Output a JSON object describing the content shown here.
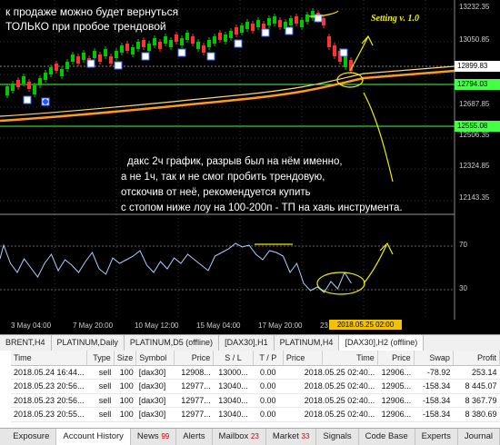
{
  "colors": {
    "background": "#000000",
    "candle_up": "#00c800",
    "candle_down": "#ff3333",
    "ma_outer": "#ff9a1a",
    "ma_inner": "#ffd27a",
    "annotation": "#f0f000",
    "oscillator": "#a9cfff",
    "green_level": "#44ff44",
    "current_price": "#ffffff"
  },
  "annotations": {
    "top_line1": "к продаже можно будет вернуться",
    "top_line2": "ТОЛЬКО при пробое трендовой",
    "setting": "Setting v. 1.0",
    "mid_line1": "дакс 2ч график, разрыв был на нём именно,",
    "mid_line2": "а не 1ч, так и не смог пробить трендовую,",
    "mid_line3": "отскочив от неё, рекомендуется купить",
    "mid_line4": "с стопом ниже лоу на 100-200п - ТП на хаяь инструмента."
  },
  "price_axis": {
    "labels": [
      "13232.35",
      "13050.85",
      "12899.83",
      "12794.03",
      "12687.85",
      "12555.08",
      "12506.35",
      "12324.85",
      "12143.35"
    ],
    "current_price": "12899.83",
    "level_1": "12794.03",
    "level_2": "12555.08"
  },
  "oscillator_axis": {
    "labels": [
      "70",
      "30"
    ]
  },
  "date_axis": {
    "labels": [
      "3 May 04:00",
      "7 May 20:00",
      "10 May 12:00",
      "15 May 04:00",
      "17 May 20:00",
      "23"
    ],
    "cursor_label": "2018.05.25 02:00"
  },
  "chart_tabs": [
    {
      "label": "BRENT,H4",
      "active": false
    },
    {
      "label": "PLATINUM,Daily",
      "active": false
    },
    {
      "label": "PLATINUM,D5 (offline)",
      "active": false
    },
    {
      "label": "[DAX30],H1",
      "active": false
    },
    {
      "label": "PLATINUM,H4",
      "active": false
    },
    {
      "label": "[DAX30],H2 (offline)",
      "active": true
    }
  ],
  "table": {
    "headers": [
      "Time",
      "Type",
      "Size",
      "Symbol",
      "Price",
      "S / L",
      "T / P",
      "Price",
      "Time",
      "Price",
      "Swap",
      "Profit"
    ],
    "rows": [
      [
        "2018.05.24 16:44...",
        "sell",
        "100",
        "[dax30]",
        "12908...",
        "13000...",
        "0.00",
        "2018.05.25 02:40...",
        "12906...",
        "-78.92",
        "253.14"
      ],
      [
        "2018.05.23 20:56...",
        "sell",
        "100",
        "[dax30]",
        "12977...",
        "13040...",
        "0.00",
        "2018.05.25 02:40...",
        "12905...",
        "-158.34",
        "8 445.07"
      ],
      [
        "2018.05.23 20:56...",
        "sell",
        "100",
        "[dax30]",
        "12977...",
        "13040...",
        "0.00",
        "2018.05.25 02:40...",
        "12906...",
        "-158.34",
        "8 367.79"
      ],
      [
        "2018.05.23 20:55...",
        "sell",
        "100",
        "[dax30]",
        "12977...",
        "13040...",
        "0.00",
        "2018.05.25 02:40...",
        "12906...",
        "-158.34",
        "8 380.69"
      ]
    ]
  },
  "bottom_tabs": [
    {
      "label": "Exposure",
      "count": "",
      "active": false
    },
    {
      "label": "Account History",
      "count": "",
      "active": true
    },
    {
      "label": "News",
      "count": "99",
      "active": false
    },
    {
      "label": "Alerts",
      "count": "",
      "active": false
    },
    {
      "label": "Mailbox",
      "count": "23",
      "active": false
    },
    {
      "label": "Market",
      "count": "33",
      "active": false
    },
    {
      "label": "Signals",
      "count": "",
      "active": false
    },
    {
      "label": "Code Base",
      "count": "",
      "active": false
    },
    {
      "label": "Experts",
      "count": "",
      "active": false
    },
    {
      "label": "Journal",
      "count": "",
      "active": false
    }
  ]
}
